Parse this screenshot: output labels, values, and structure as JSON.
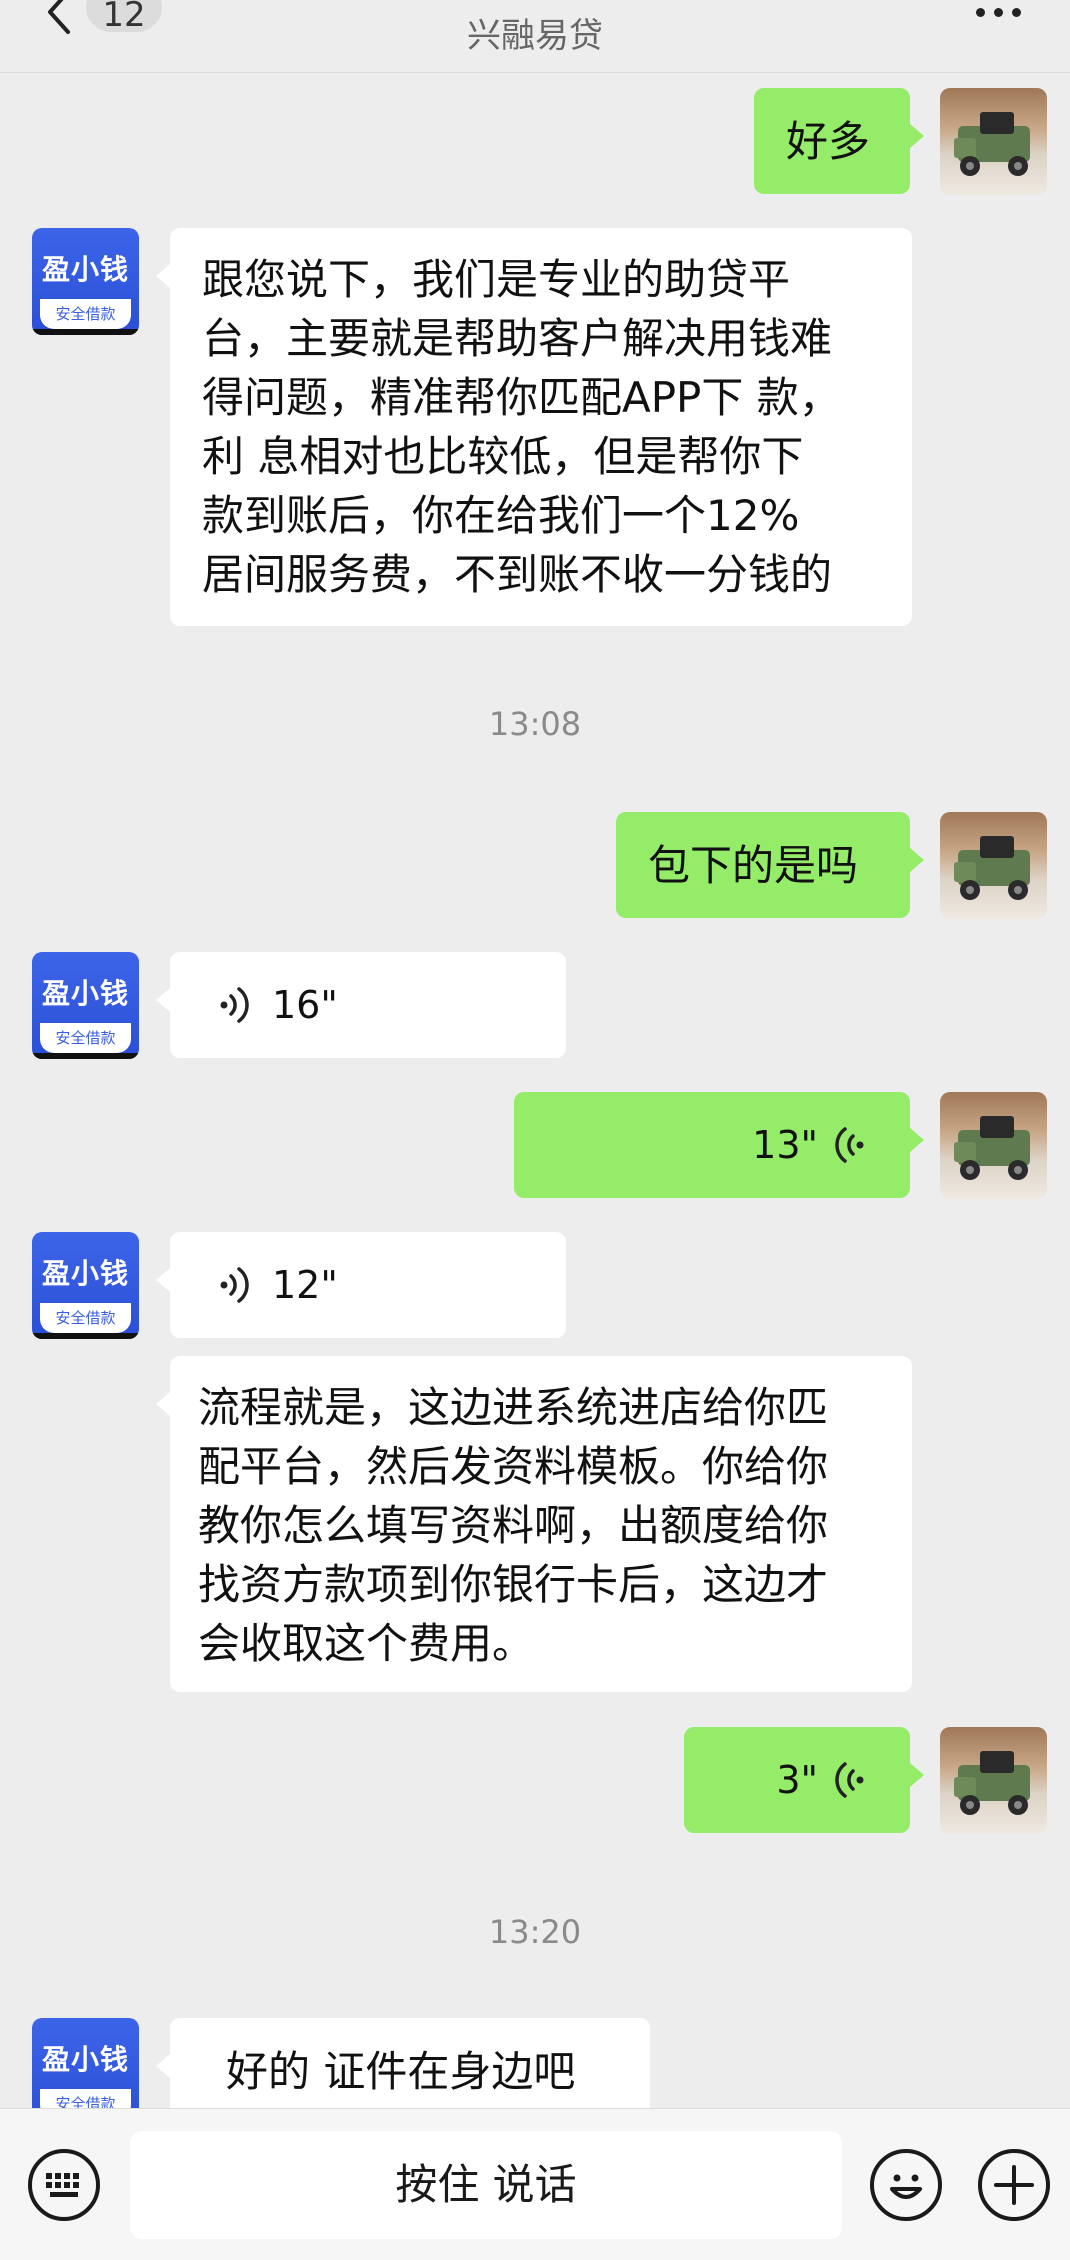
{
  "header": {
    "title": "兴融易贷",
    "unread_count": "12"
  },
  "bot_avatar": {
    "brand": "盈小钱",
    "tag": "安全借款"
  },
  "messages": {
    "m1": "好多",
    "m2": [
      "跟您说下，我们是专业的助贷平",
      "台，主要就是帮助客户解决用钱难",
      "得问题，精准帮你匹配APP下 款，",
      "利 息相对也比较低，但是帮你下",
      "款到账后，你在给我们一个12%",
      "居间服务费，不到账不收一分钱的"
    ],
    "t1": "13:08",
    "m3": "包下的是吗",
    "m4": "16\"",
    "m5": "13\"",
    "m6": "12\"",
    "m7": [
      "流程就是，这边进系统进店给你匹",
      "配平台，然后发资料模板。你给你",
      "教你怎么填写资料啊，出额度给你",
      "找资方款项到你银行卡后，这边才",
      "会收取这个费用。"
    ],
    "m8": "3\"",
    "t2": "13:20",
    "m9": "好的 证件在身边吧"
  },
  "bottom_bar": {
    "hold_to_talk": "按住 说话"
  },
  "colors": {
    "outgoing_bubble": "#95ec69",
    "incoming_bubble": "#ffffff",
    "background": "#ededed"
  }
}
